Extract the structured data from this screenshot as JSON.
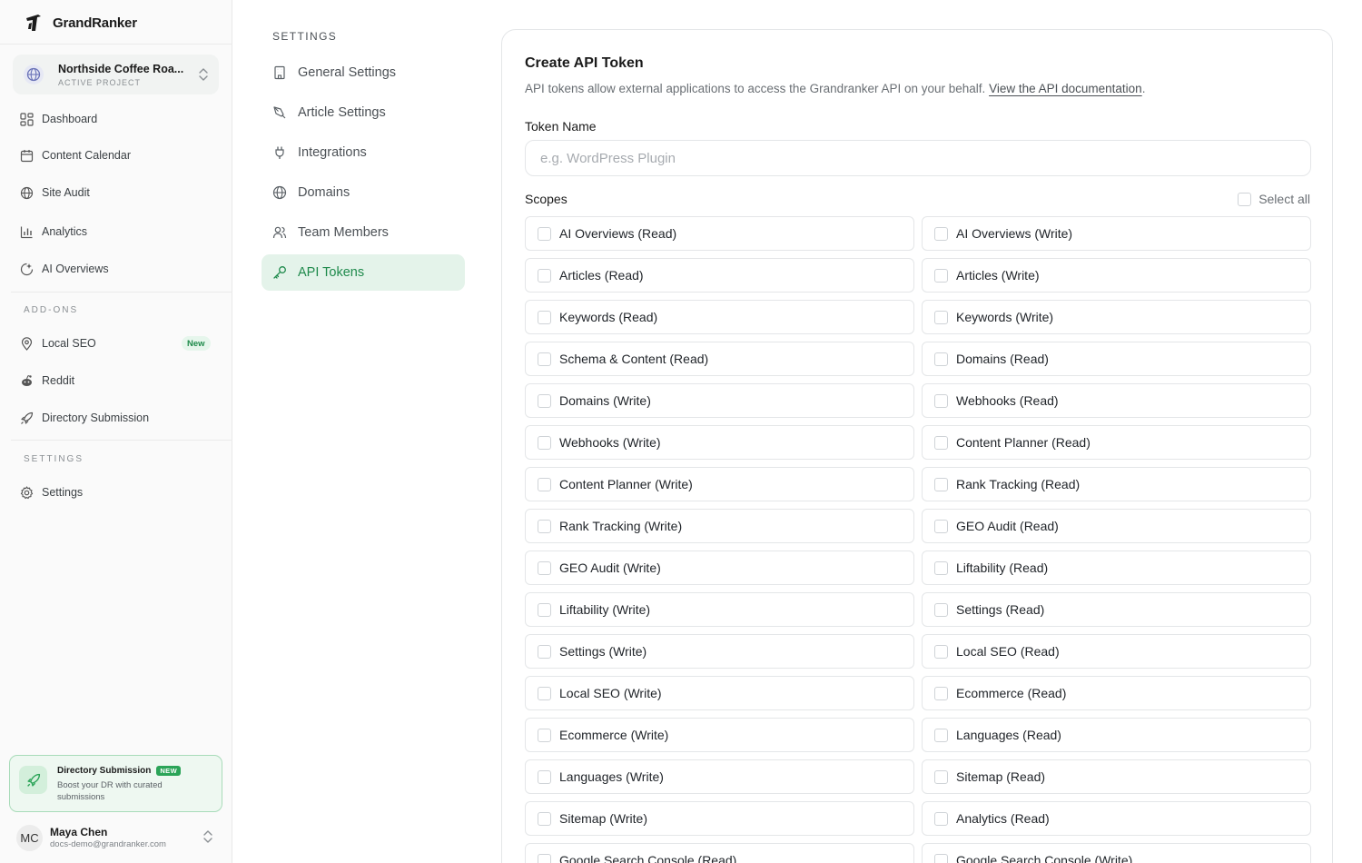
{
  "brand": {
    "name": "GrandRanker"
  },
  "project": {
    "name": "Northside Coffee Roa...",
    "status": "ACTIVE PROJECT"
  },
  "nav": {
    "main": [
      {
        "label": "Dashboard",
        "icon": "dashboard-icon"
      },
      {
        "label": "Content Calendar",
        "icon": "calendar-icon"
      },
      {
        "label": "Site Audit",
        "icon": "globe-icon"
      },
      {
        "label": "Analytics",
        "icon": "bar-chart-icon"
      },
      {
        "label": "AI Overviews",
        "icon": "ai-overviews-icon"
      }
    ],
    "addons_label": "ADD-ONS",
    "addons": [
      {
        "label": "Local SEO",
        "icon": "map-pin-icon",
        "badge": "New"
      },
      {
        "label": "Reddit",
        "icon": "reddit-icon"
      },
      {
        "label": "Directory Submission",
        "icon": "rocket-icon"
      }
    ],
    "settings_label": "SETTINGS",
    "settings": [
      {
        "label": "Settings",
        "icon": "gear-icon"
      }
    ]
  },
  "promo": {
    "title": "Directory Submission",
    "tag": "NEW",
    "description": "Boost your DR with curated submissions"
  },
  "user": {
    "initials": "MC",
    "name": "Maya Chen",
    "email": "docs-demo@grandranker.com"
  },
  "settings_menu": {
    "title": "SETTINGS",
    "items": [
      {
        "label": "General Settings",
        "icon": "building-icon",
        "active": false
      },
      {
        "label": "Article Settings",
        "icon": "pen-tool-icon",
        "active": false
      },
      {
        "label": "Integrations",
        "icon": "plug-icon",
        "active": false
      },
      {
        "label": "Domains",
        "icon": "globe-icon",
        "active": false
      },
      {
        "label": "Team Members",
        "icon": "users-icon",
        "active": false
      },
      {
        "label": "API Tokens",
        "icon": "key-icon",
        "active": true
      }
    ]
  },
  "form": {
    "title": "Create API Token",
    "description": "API tokens allow external applications to access the Grandranker API on your behalf.",
    "doc_link": "View the API documentation",
    "doc_link_suffix": ".",
    "token_name_label": "Token Name",
    "token_name_placeholder": "e.g. WordPress Plugin",
    "token_name_value": "",
    "scopes_label": "Scopes",
    "select_all_label": "Select all",
    "scopes": [
      "AI Overviews (Read)",
      "AI Overviews (Write)",
      "Articles (Read)",
      "Articles (Write)",
      "Keywords (Read)",
      "Keywords (Write)",
      "Schema & Content (Read)",
      "Domains (Read)",
      "Domains (Write)",
      "Webhooks (Read)",
      "Webhooks (Write)",
      "Content Planner (Read)",
      "Content Planner (Write)",
      "Rank Tracking (Read)",
      "Rank Tracking (Write)",
      "GEO Audit (Read)",
      "GEO Audit (Write)",
      "Liftability (Read)",
      "Liftability (Write)",
      "Settings (Read)",
      "Settings (Write)",
      "Local SEO (Read)",
      "Local SEO (Write)",
      "Ecommerce (Read)",
      "Ecommerce (Write)",
      "Languages (Read)",
      "Languages (Write)",
      "Sitemap (Read)",
      "Sitemap (Write)",
      "Analytics (Read)",
      "Google Search Console (Read)",
      "Google Search Console (Write)"
    ]
  },
  "colors": {
    "accent": "#1f8a4c",
    "accent_bg": "#e4f3ea",
    "border": "#e4e6e8"
  }
}
